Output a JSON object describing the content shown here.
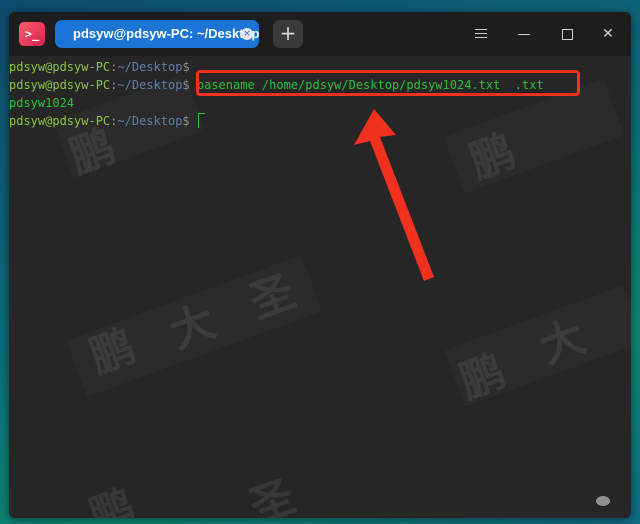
{
  "app": {
    "icon_glyph": ">_",
    "tab_title": "pdsyw@pdsyw-PC: ~/Desktop",
    "tab_close_glyph": "×",
    "new_tab_glyph": "+",
    "close_glyph": "✕"
  },
  "terminal": {
    "lines": [
      {
        "user": "pdsyw@pdsyw-PC",
        "colon": ":",
        "path": "~/Desktop",
        "dollar": "$",
        "cmd": ""
      },
      {
        "user": "pdsyw@pdsyw-PC",
        "colon": ":",
        "path": "~/Desktop",
        "dollar": "$",
        "cmd": " basename /home/pdsyw/Desktop/pdsyw1024.txt  .txt"
      },
      {
        "output": "pdsyw1024"
      },
      {
        "user": "pdsyw@pdsyw-PC",
        "colon": ":",
        "path": "~/Desktop",
        "dollar": "$",
        "cmd": ""
      }
    ]
  },
  "watermark": {
    "chars": [
      "鹏",
      "大",
      "圣"
    ]
  },
  "colors": {
    "prompt_user": "#8cc63f",
    "prompt_path": "#5f7fa6",
    "command": "#29c23a",
    "annotation": "#f1301e",
    "tab_active": "#1b74d6"
  }
}
